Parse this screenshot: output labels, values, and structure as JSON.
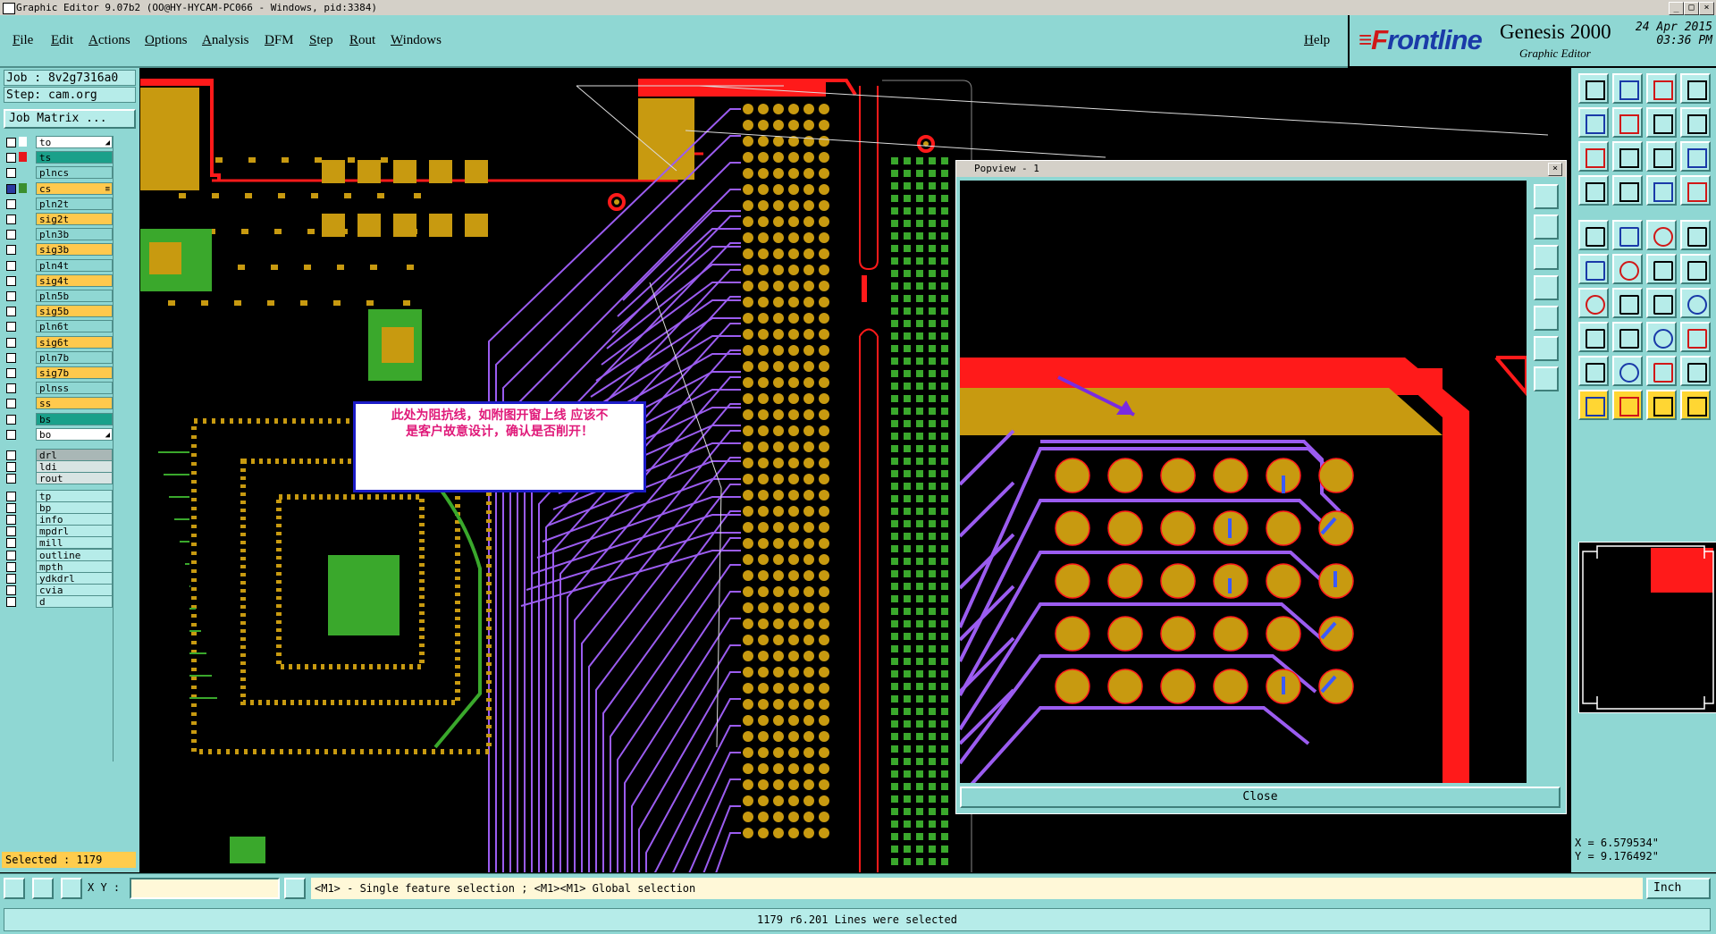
{
  "window": {
    "title": "Graphic Editor 9.07b2 (OO@HY-HYCAM-PC066 - Windows, pid:3384)"
  },
  "menu": {
    "items": [
      "File",
      "Edit",
      "Actions",
      "Options",
      "Analysis",
      "DFM",
      "Step",
      "Rout",
      "Windows"
    ],
    "help": "Help"
  },
  "brand": {
    "logo_f": "F",
    "logo_rest": "rontline",
    "product": "Genesis 2000",
    "subtitle": "Graphic Editor",
    "date": "24 Apr 2015",
    "time": "03:36 PM"
  },
  "job": {
    "job_label": "Job : 8v2g7316a0",
    "step_label": "Step: cam.org",
    "matrix_button": "Job Matrix ..."
  },
  "layers": [
    {
      "name": "to",
      "color": "#ffffff",
      "icon": "#ffffff",
      "checked": false,
      "arrow": true
    },
    {
      "name": "ts",
      "color": "#1aa08a",
      "icon": "#e8161c",
      "checked": false
    },
    {
      "name": "plncs",
      "color": "#8fd7d3",
      "icon": "",
      "checked": false
    },
    {
      "name": "cs",
      "color": "#ffc94d",
      "icon": "#3b8f2f",
      "checked": true,
      "arrow": true
    },
    {
      "name": "pln2t",
      "color": "#8fd7d3",
      "icon": "",
      "checked": false
    },
    {
      "name": "sig2t",
      "color": "#ffc94d",
      "icon": "",
      "checked": false
    },
    {
      "name": "pln3b",
      "color": "#8fd7d3",
      "icon": "",
      "checked": false
    },
    {
      "name": "sig3b",
      "color": "#ffc94d",
      "icon": "",
      "checked": false
    },
    {
      "name": "pln4t",
      "color": "#8fd7d3",
      "icon": "",
      "checked": false
    },
    {
      "name": "sig4t",
      "color": "#ffc94d",
      "icon": "",
      "checked": false
    },
    {
      "name": "pln5b",
      "color": "#8fd7d3",
      "icon": "",
      "checked": false
    },
    {
      "name": "sig5b",
      "color": "#ffc94d",
      "icon": "",
      "checked": false
    },
    {
      "name": "pln6t",
      "color": "#8fd7d3",
      "icon": "",
      "checked": false
    },
    {
      "name": "sig6t",
      "color": "#ffc94d",
      "icon": "",
      "checked": false
    },
    {
      "name": "pln7b",
      "color": "#8fd7d3",
      "icon": "",
      "checked": false
    },
    {
      "name": "sig7b",
      "color": "#ffc94d",
      "icon": "",
      "checked": false
    },
    {
      "name": "plnss",
      "color": "#8fd7d3",
      "icon": "",
      "checked": false
    },
    {
      "name": "ss",
      "color": "#ffc94d",
      "icon": "",
      "checked": false
    },
    {
      "name": "bs",
      "color": "#1aa08a",
      "icon": "",
      "checked": false
    },
    {
      "name": "bo",
      "color": "#ffffff",
      "icon": "",
      "checked": false,
      "arrow": true
    },
    {
      "name": "drl",
      "color": "#a9b7b6",
      "icon": "",
      "checked": false
    },
    {
      "name": "ldi",
      "color": "#d8e4e3",
      "icon": "",
      "checked": false
    },
    {
      "name": "rout",
      "color": "#d8e4e3",
      "icon": "",
      "checked": false
    },
    {
      "name": "tp",
      "color": "#b6ece9",
      "icon": "",
      "checked": false
    },
    {
      "name": "bp",
      "color": "#b6ece9",
      "icon": "",
      "checked": false
    },
    {
      "name": "info",
      "color": "#b6ece9",
      "icon": "",
      "checked": false
    },
    {
      "name": "mpdrl",
      "color": "#b6ece9",
      "icon": "",
      "checked": false
    },
    {
      "name": "mill",
      "color": "#b6ece9",
      "icon": "",
      "checked": false
    },
    {
      "name": "outline",
      "color": "#b6ece9",
      "icon": "",
      "checked": false
    },
    {
      "name": "mpth",
      "color": "#b6ece9",
      "icon": "",
      "checked": false
    },
    {
      "name": "ydkdrl",
      "color": "#b6ece9",
      "icon": "",
      "checked": false
    },
    {
      "name": "cvia",
      "color": "#b6ece9",
      "icon": "",
      "checked": false
    },
    {
      "name": "d",
      "color": "#b6ece9",
      "icon": "",
      "checked": false
    }
  ],
  "selected_count": "Selected : 1179",
  "annotation": {
    "line1": "此处为阻抗线，如附图开窗上线  应该不",
    "line2": "是客户故意设计，确认是否削开！"
  },
  "popview": {
    "title": "Popview - 1",
    "close_button": "Close"
  },
  "coords": {
    "x": "X = 6.579534\"",
    "y": "Y = 9.176492\""
  },
  "cmd": {
    "xy_label": "X Y :",
    "xy_value": "",
    "hint": "<M1> - Single feature selection ; <M1><M1> Global selection",
    "unit": "Inch"
  },
  "status": "1179 r6.201 Lines were selected",
  "colors": {
    "panel": "#8fd7d3",
    "copper": "#c89a10",
    "mask": "#ff1a1a",
    "trace": "#9b5cf0",
    "green": "#3aa82c"
  },
  "tools": [
    "open-icon",
    "save-icon",
    "home-icon",
    "grid-icon",
    "step-back-icon",
    "step-fwd-icon",
    "zoom-fit-icon",
    "window-icon",
    "resize-icon",
    "pan-icon",
    "scale-1-2-icon",
    "help-icon",
    "snap-icon",
    "layer-grid-icon",
    "measure-icon",
    "compare-icon",
    "pad-icon",
    "polygon-icon",
    "line-icon",
    "dot-icon",
    "node-icon",
    "cross-icon",
    "add-icon",
    "delete-icon",
    "draw-line-icon",
    "diag-icon",
    "rotate-icon",
    "mirror-icon",
    "copy-pad-icon",
    "horiz-icon",
    "align-icon",
    "split-icon",
    "tri-a-icon",
    "tri-b-icon",
    "tri-c-icon",
    "tri-d-icon",
    "select-icon",
    "select-alt-icon",
    "select-box-icon",
    "select-all-icon"
  ]
}
